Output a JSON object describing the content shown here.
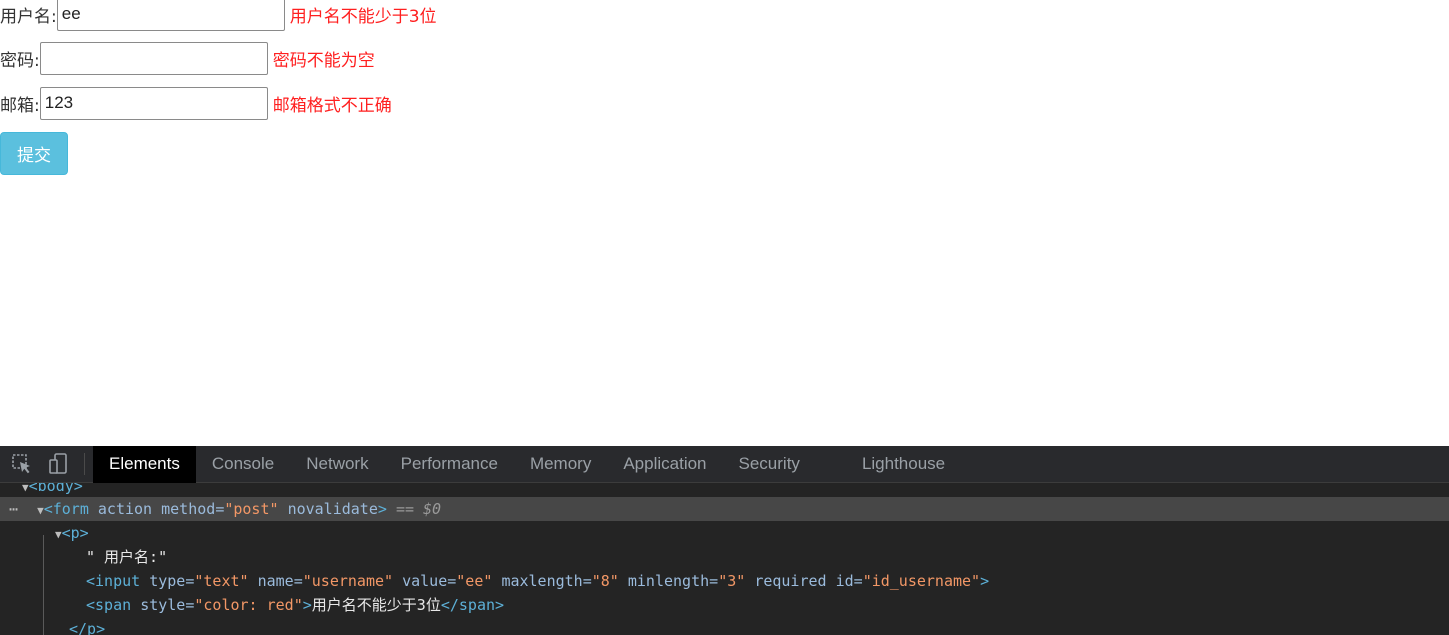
{
  "form": {
    "username": {
      "label": "用户名:",
      "value": "ee",
      "error": "用户名不能少于3位"
    },
    "password": {
      "label": "密码:",
      "value": "",
      "error": "密码不能为空"
    },
    "email": {
      "label": "邮箱:",
      "value": "123",
      "error": "邮箱格式不正确"
    },
    "submit_label": "提交"
  },
  "devtools": {
    "tabs": [
      "Elements",
      "Console",
      "Network",
      "Performance",
      "Memory",
      "Application",
      "Security",
      "Lighthouse"
    ],
    "active_tab": "Elements",
    "icons": [
      "inspect-element-icon",
      "device-toolbar-icon"
    ],
    "dom_lines": {
      "body_tag": "<body>",
      "form_open": "<form",
      "form_attr_action": "action",
      "form_attr_method": "method",
      "form_method_value": "\"post\"",
      "form_attr_novalidate": "novalidate",
      "form_close": ">",
      "selected_marker": "== $0",
      "p_open": "<p>",
      "text_node": "\" 用户名:\"",
      "input_open": "<input",
      "input_type_attr": "type",
      "input_type_val": "\"text\"",
      "input_name_attr": "name",
      "input_name_val": "\"username\"",
      "input_value_attr": "value",
      "input_value_val": "\"ee\"",
      "input_maxlength_attr": "maxlength",
      "input_maxlength_val": "\"8\"",
      "input_minlength_attr": "minlength",
      "input_minlength_val": "\"3\"",
      "input_required_attr": "required",
      "input_id_attr": "id",
      "input_id_val": "\"id_username\"",
      "input_close": ">",
      "span_open": "<span",
      "span_style_attr": "style",
      "span_style_val": "\"color: red\"",
      "span_open_close": ">",
      "span_text": "用户名不能少于3位",
      "span_close": "</span>",
      "p_close": "</p>"
    }
  }
}
